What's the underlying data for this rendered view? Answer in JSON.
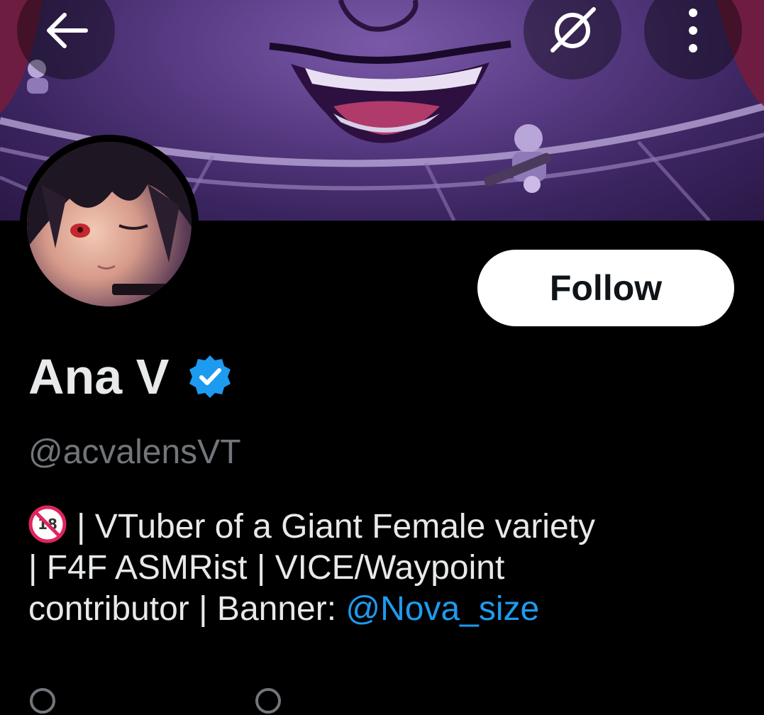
{
  "header": {
    "back_icon": "arrow-left-icon",
    "search_icon": "search-off-icon",
    "more_icon": "more-vertical-icon"
  },
  "profile": {
    "display_name": "Ana V",
    "verified": true,
    "handle": "@acvalensVT",
    "follow_label": "Follow",
    "bio": {
      "age_icon": "under-18-prohibited-icon",
      "line1": "| VTuber of a Giant Female variety",
      "line2": "| F4F ASMRist | VICE/Waypoint",
      "line3_prefix": "contributor | Banner: ",
      "mention": "@Nova_size"
    }
  },
  "colors": {
    "background": "#000000",
    "text_primary": "#e7e9ea",
    "text_secondary": "#71767b",
    "link": "#1d9bf0",
    "verified_badge": "#1d9bf0",
    "follow_bg": "#ffffff",
    "follow_text": "#0f1419"
  }
}
